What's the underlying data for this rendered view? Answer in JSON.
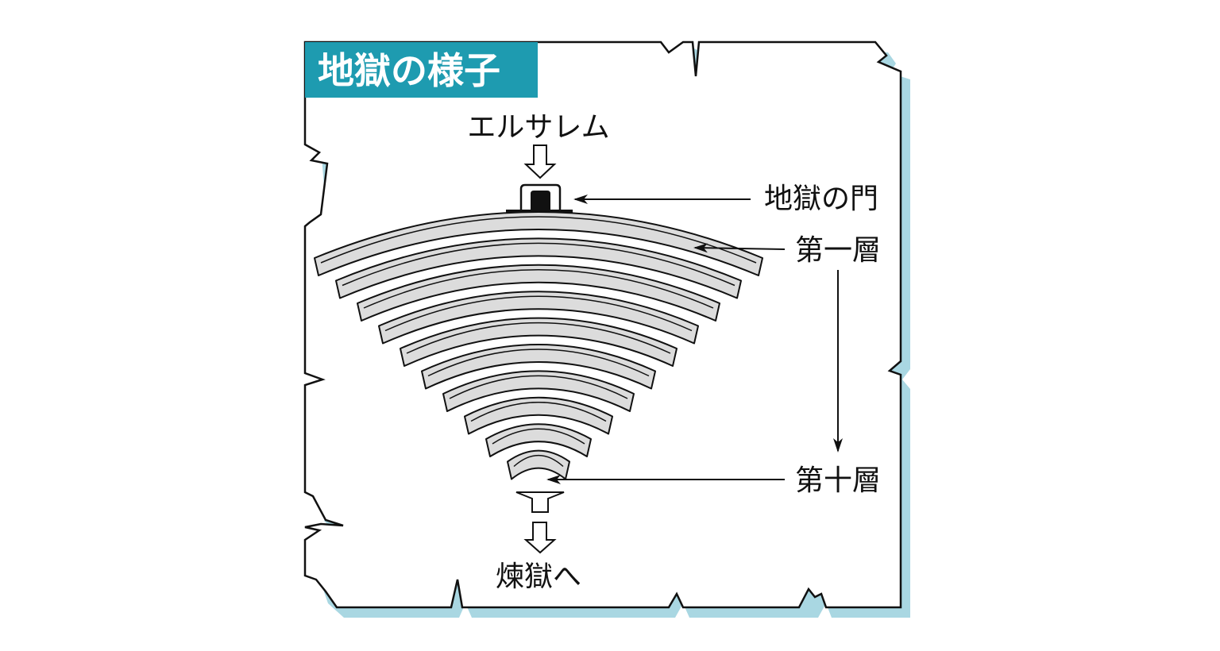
{
  "title": "地獄の様子",
  "labels": {
    "top": "エルサレム",
    "gate": "地獄の門",
    "first_layer": "第一層",
    "tenth_layer": "第十層",
    "bottom": "煉獄へ"
  },
  "layer_count": 10,
  "colors": {
    "title_bg": "#1e9bb0",
    "title_text": "#ffffff",
    "shadow": "#a9d7e2",
    "layer_fill": "#dcdcdc",
    "outline": "#111111",
    "paper": "#ffffff"
  }
}
